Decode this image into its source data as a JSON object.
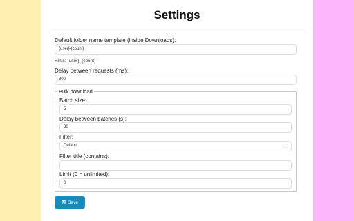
{
  "page": {
    "title": "Settings"
  },
  "settings": {
    "folder_template_label": "Default folder name template (inside Downloads):",
    "folder_template_value": "{user}-{count}",
    "hints": "Hints: {user}, {count}",
    "delay_label": "Delay between requests (ms):",
    "delay_value": "300"
  },
  "bulk": {
    "legend": "Bulk download",
    "batch_size_label": "Batch size:",
    "batch_size_value": "5",
    "batch_delay_label": "Delay between batches (s):",
    "batch_delay_value": "30",
    "filter_label": "Filter:",
    "filter_value": "Default",
    "filter_title_label": "Filter title (contains):",
    "filter_title_value": "",
    "limit_label": "Limit (0 = unlimited):",
    "limit_value": "0"
  },
  "actions": {
    "save_label": "Save"
  },
  "colors": {
    "left_bg": "#fdf0b0",
    "right_bg": "#fcb4fa",
    "accent": "#1a8ab8"
  },
  "icons": {
    "save": "floppy-disk-icon",
    "select": "chevron-down-icon"
  }
}
